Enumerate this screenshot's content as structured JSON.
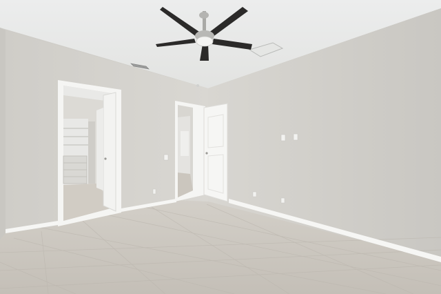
{
  "scene": {
    "kind": "photo",
    "subject": "empty-bedroom",
    "colors": {
      "ceiling": "#e7e8e6",
      "wall_left": "#d6d4cf",
      "wall_back": "#d9d7d2",
      "wall_right": "#cdcbc6",
      "trim": "#f7f7f5",
      "floor": "#cbc7c0",
      "floor_grout": "#b9b4ac",
      "fan_blade": "#2b2a29",
      "fan_metal": "#a9a9a6"
    }
  }
}
